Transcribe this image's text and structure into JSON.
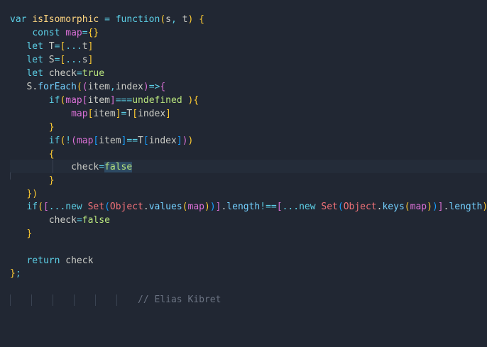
{
  "editor": {
    "lines": [
      "var isIsomorphic = function(s, t) {",
      "    const map={}",
      "   let T=[...t]",
      "   let S=[...s]",
      "   let check=true",
      "   S.forEach((item,index)=>{",
      "       if(map[item]===undefined ){",
      "           map[item]=T[index]",
      "       }",
      "       if(!(map[item]==T[index]))",
      "       {",
      "           check=false",
      "       }",
      "   })",
      "   if([...new Set(Object.values(map))].length!==[...new Set(Object.keys(map))].length){",
      "       check=false",
      "   }",
      "",
      "   return check",
      "};",
      "",
      "                       // Elias Kibret"
    ],
    "comment": "// Elias Kibret",
    "colors": {
      "background": "#212733",
      "keyword": "#5ccfe6",
      "text": "#cbccc6",
      "bracket_yellow": "#ffcc33",
      "bracket_magenta": "#da70d6",
      "bracket_blue": "#179fff",
      "boolean": "#bae67e",
      "comment": "#6b7382"
    }
  }
}
